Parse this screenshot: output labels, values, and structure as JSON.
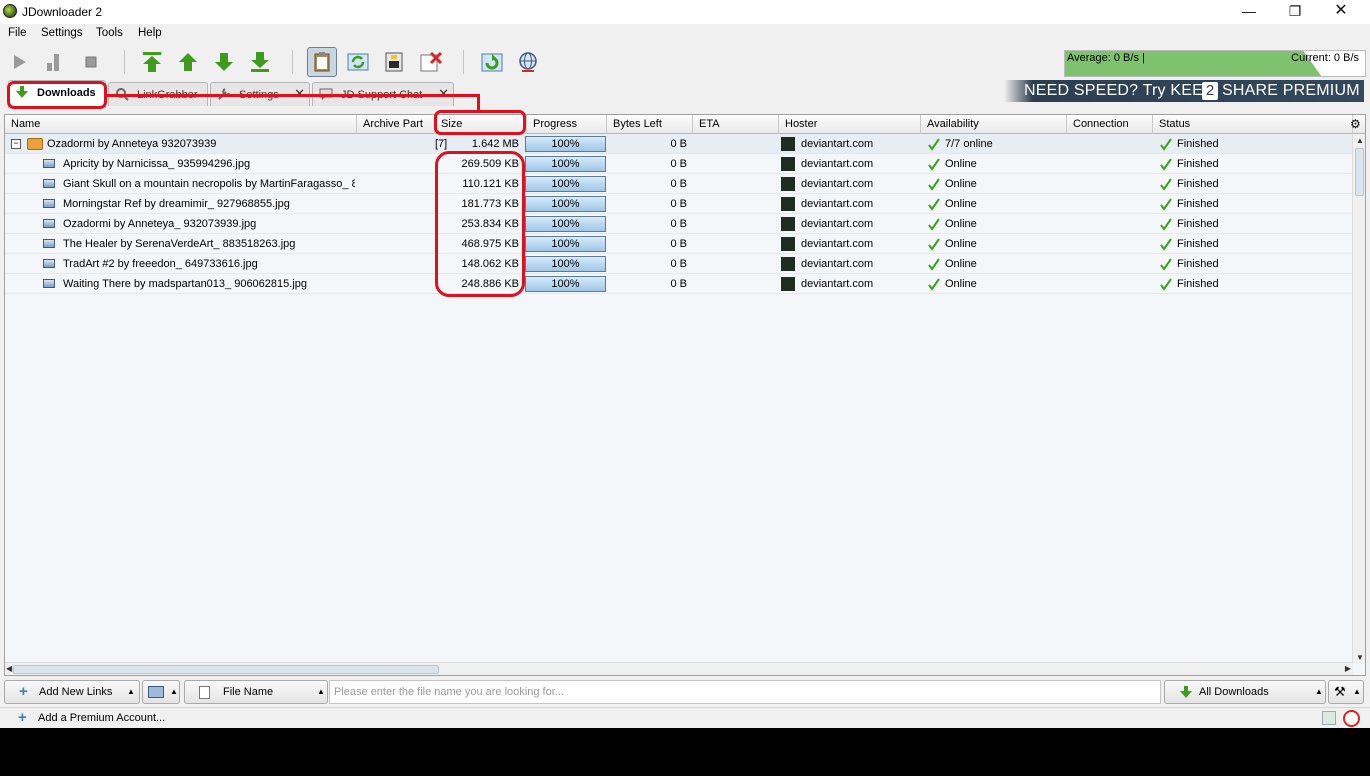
{
  "window": {
    "title": "JDownloader 2"
  },
  "menu": [
    "File",
    "Settings",
    "Tools",
    "Help"
  ],
  "speed": {
    "average": "Average: 0 B/s |",
    "current": "Current: 0 B/s"
  },
  "tabs": [
    {
      "label": "Downloads"
    },
    {
      "label": "LinkGrabber"
    },
    {
      "label": "Settings"
    },
    {
      "label": "JD Support Chat"
    }
  ],
  "promo": {
    "prefix": "NEED SPEED? Try KEEP",
    "number": "2",
    "suffix": "SHARE PREMIUM"
  },
  "columns": [
    "Name",
    "Archive Part",
    "Size",
    "Progress",
    "Bytes Left",
    "ETA",
    "Hoster",
    "Availability",
    "Connection",
    "Status"
  ],
  "package": {
    "expander": "−",
    "name": "Ozadormi by Anneteya 932073939",
    "archive_part": "[7]",
    "size": "1.642 MB",
    "progress": "100%",
    "bytes_left": "0 B",
    "hoster": "deviantart.com",
    "availability": "7/7 online",
    "status": "Finished",
    "progress_fraction": 1.0
  },
  "files": [
    {
      "name": "Apricity by Narnicissa_ 935994296.jpg",
      "size": "269.509 KB",
      "progress": "100%",
      "bytes_left": "0 B",
      "hoster": "deviantart.com",
      "availability": "Online",
      "status": "Finished"
    },
    {
      "name": "Giant Skull on a mountain necropolis by MartinFaragasso_ 8.",
      "size": "110.121 KB",
      "progress": "100%",
      "bytes_left": "0 B",
      "hoster": "deviantart.com",
      "availability": "Online",
      "status": "Finished"
    },
    {
      "name": "Morningstar Ref by dreamimir_ 927968855.jpg",
      "size": "181.773 KB",
      "progress": "100%",
      "bytes_left": "0 B",
      "hoster": "deviantart.com",
      "availability": "Online",
      "status": "Finished"
    },
    {
      "name": "Ozadormi by Anneteya_ 932073939.jpg",
      "size": "253.834 KB",
      "progress": "100%",
      "bytes_left": "0 B",
      "hoster": "deviantart.com",
      "availability": "Online",
      "status": "Finished"
    },
    {
      "name": "The Healer by SerenaVerdeArt_ 883518263.jpg",
      "size": "468.975 KB",
      "progress": "100%",
      "bytes_left": "0 B",
      "hoster": "deviantart.com",
      "availability": "Online",
      "status": "Finished"
    },
    {
      "name": "TradArt #2 by freeedon_ 649733616.jpg",
      "size": "148.062 KB",
      "progress": "100%",
      "bytes_left": "0 B",
      "hoster": "deviantart.com",
      "availability": "Online",
      "status": "Finished"
    },
    {
      "name": "Waiting There by madspartan013_ 906062815.jpg",
      "size": "248.886 KB",
      "progress": "100%",
      "bytes_left": "0 B",
      "hoster": "deviantart.com",
      "availability": "Online",
      "status": "Finished"
    }
  ],
  "bottom": {
    "add_links": "Add New Links",
    "search_field": "File Name",
    "search_placeholder": "Please enter the file name you are looking for...",
    "filter": "All Downloads"
  },
  "statusbar": {
    "premium": "Add a Premium Account..."
  },
  "colors": {
    "annotation": "#e0101e",
    "check": "#3aa31b",
    "toolbar_arrow": "#3e9b1e"
  },
  "icons": [
    "jdownloader-logo-icon",
    "play-icon",
    "pause-icon",
    "stop-icon",
    "move-top-icon",
    "move-up-icon",
    "move-down-icon",
    "move-bottom-icon",
    "clipboard-icon",
    "reconnect-icon",
    "silent-mode-icon",
    "cleanup-icon",
    "update-icon",
    "premium-globe-icon",
    "check-icon",
    "package-icon",
    "image-file-icon",
    "deviantart-icon",
    "settings-gear-icon"
  ]
}
